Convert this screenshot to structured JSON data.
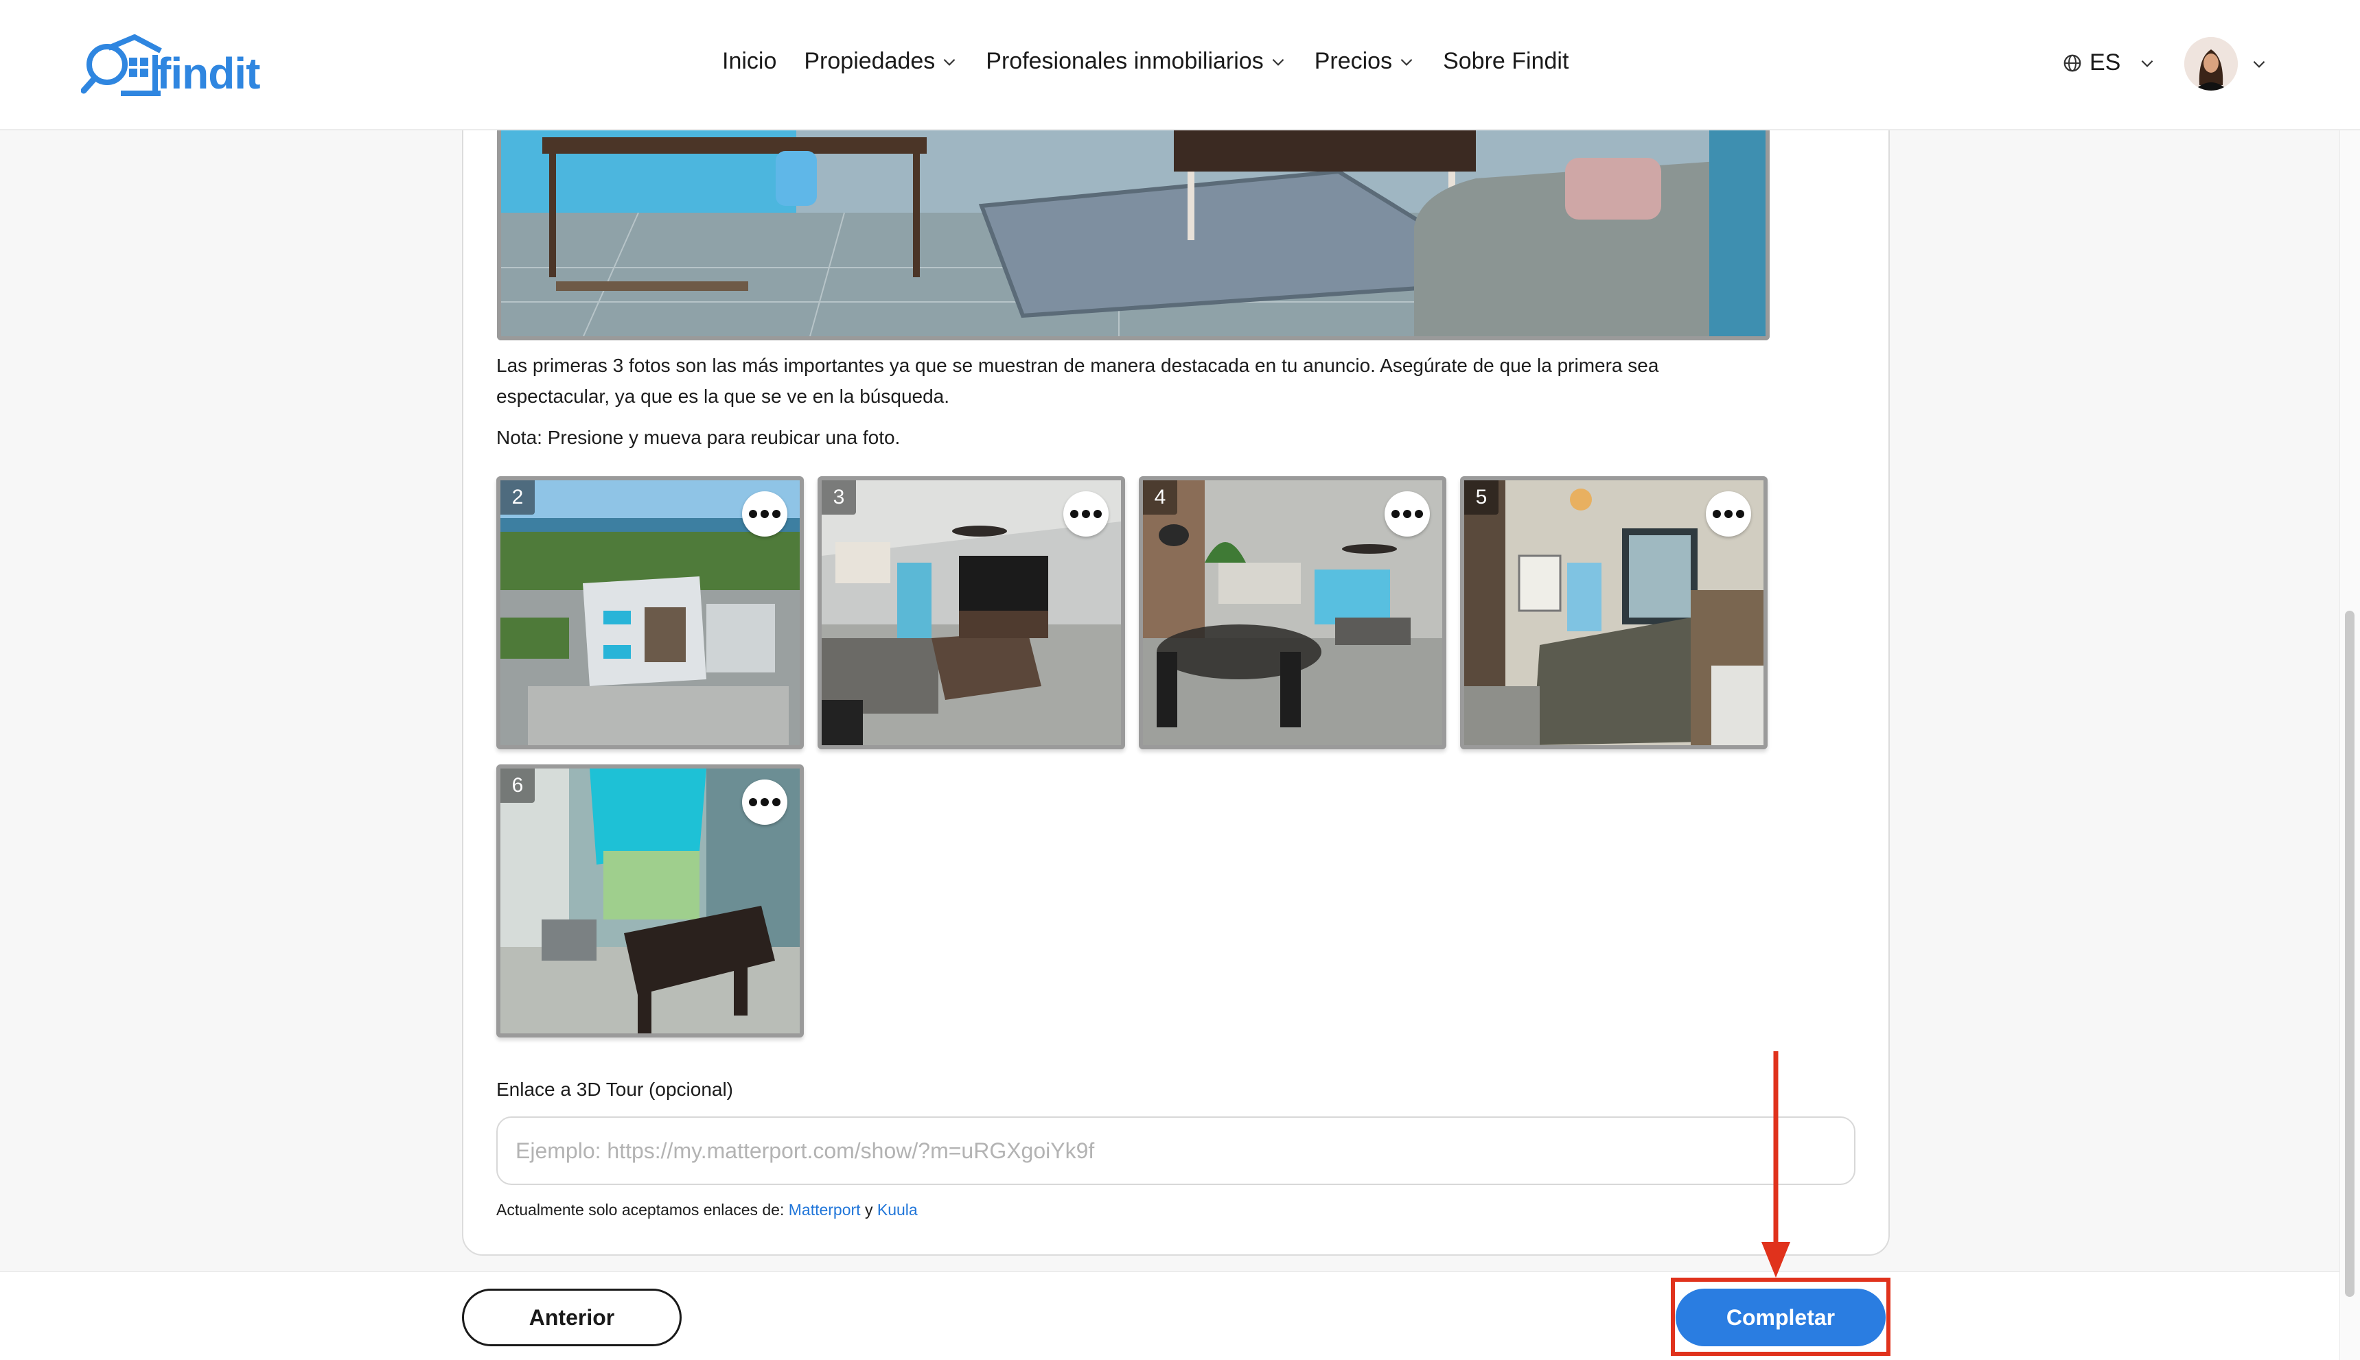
{
  "brand": {
    "name": "findit",
    "color": "#2f86e0"
  },
  "nav": [
    {
      "label": "Inicio",
      "dropdown": false
    },
    {
      "label": "Propiedades",
      "dropdown": true
    },
    {
      "label": "Profesionales inmobiliarios",
      "dropdown": true
    },
    {
      "label": "Precios",
      "dropdown": true
    },
    {
      "label": "Sobre Findit",
      "dropdown": false
    }
  ],
  "language": {
    "label": "ES",
    "icon": "globe-icon"
  },
  "user": {
    "icon": "avatar"
  },
  "photos_section": {
    "description": "Las primeras 3 fotos son las más importantes ya que se muestran de manera destacada en tu anuncio. Asegúrate de que la primera sea espectacular, ya que es la que se ve en la búsqueda.",
    "note": "Nota: Presione y mueva para reubicar una foto.",
    "photos": [
      {
        "number": "2",
        "scene": "aerial-building"
      },
      {
        "number": "3",
        "scene": "living-room"
      },
      {
        "number": "4",
        "scene": "dining-room"
      },
      {
        "number": "5",
        "scene": "bedroom"
      },
      {
        "number": "6",
        "scene": "balcony"
      }
    ]
  },
  "tour": {
    "label": "Enlace a 3D Tour (opcional)",
    "placeholder": "Ejemplo: https://my.matterport.com/show/?m=uRGXgoiYk9f",
    "value": "",
    "accepted_prefix": "Actualmente solo aceptamos enlaces de: ",
    "link1": "Matterport",
    "joiner": " y ",
    "link2": "Kuula"
  },
  "footer": {
    "prev_label": "Anterior",
    "complete_label": "Completar"
  },
  "colors": {
    "accent": "#2a7de1",
    "annotation": "#e0321c"
  }
}
